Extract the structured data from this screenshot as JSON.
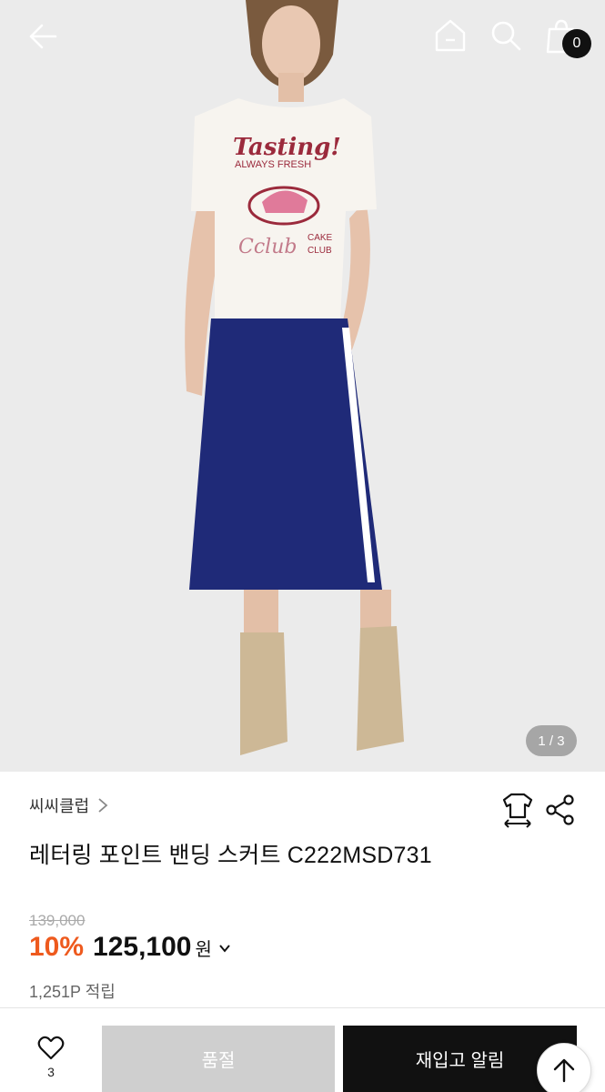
{
  "header": {
    "back_icon": "arrow-left-icon",
    "home_icon": "home-icon",
    "search_icon": "search-icon",
    "cart_icon": "shopping-bag-icon",
    "cart_count": "0"
  },
  "gallery": {
    "pager": "1 / 3",
    "shirt_print": {
      "line1": "Tasting!",
      "line2": "ALWAYS FRESH",
      "line3": "Cclub",
      "line4": "CAKE",
      "line5": "CLUB"
    }
  },
  "product": {
    "brand": "씨씨클럽",
    "brand_chevron": "chevron-right-icon",
    "fit_icon": "size-guide-icon",
    "share_icon": "share-icon",
    "title": "레터링 포인트 밴딩 스커트 C222MSD731",
    "original_price": "139,000",
    "discount": "10%",
    "price": "125,100",
    "currency": "원",
    "points": "1,251P 적립"
  },
  "bottom_bar": {
    "like_icon": "heart-icon",
    "like_count": "3",
    "soldout_label": "품절",
    "notify_label": "재입고 알림",
    "scroll_top_icon": "arrow-up-icon"
  },
  "colors": {
    "accent": "#ee5a1e",
    "dark": "#111111",
    "soldout_bg": "#cfcfcf",
    "skirt": "#1f2a78"
  }
}
